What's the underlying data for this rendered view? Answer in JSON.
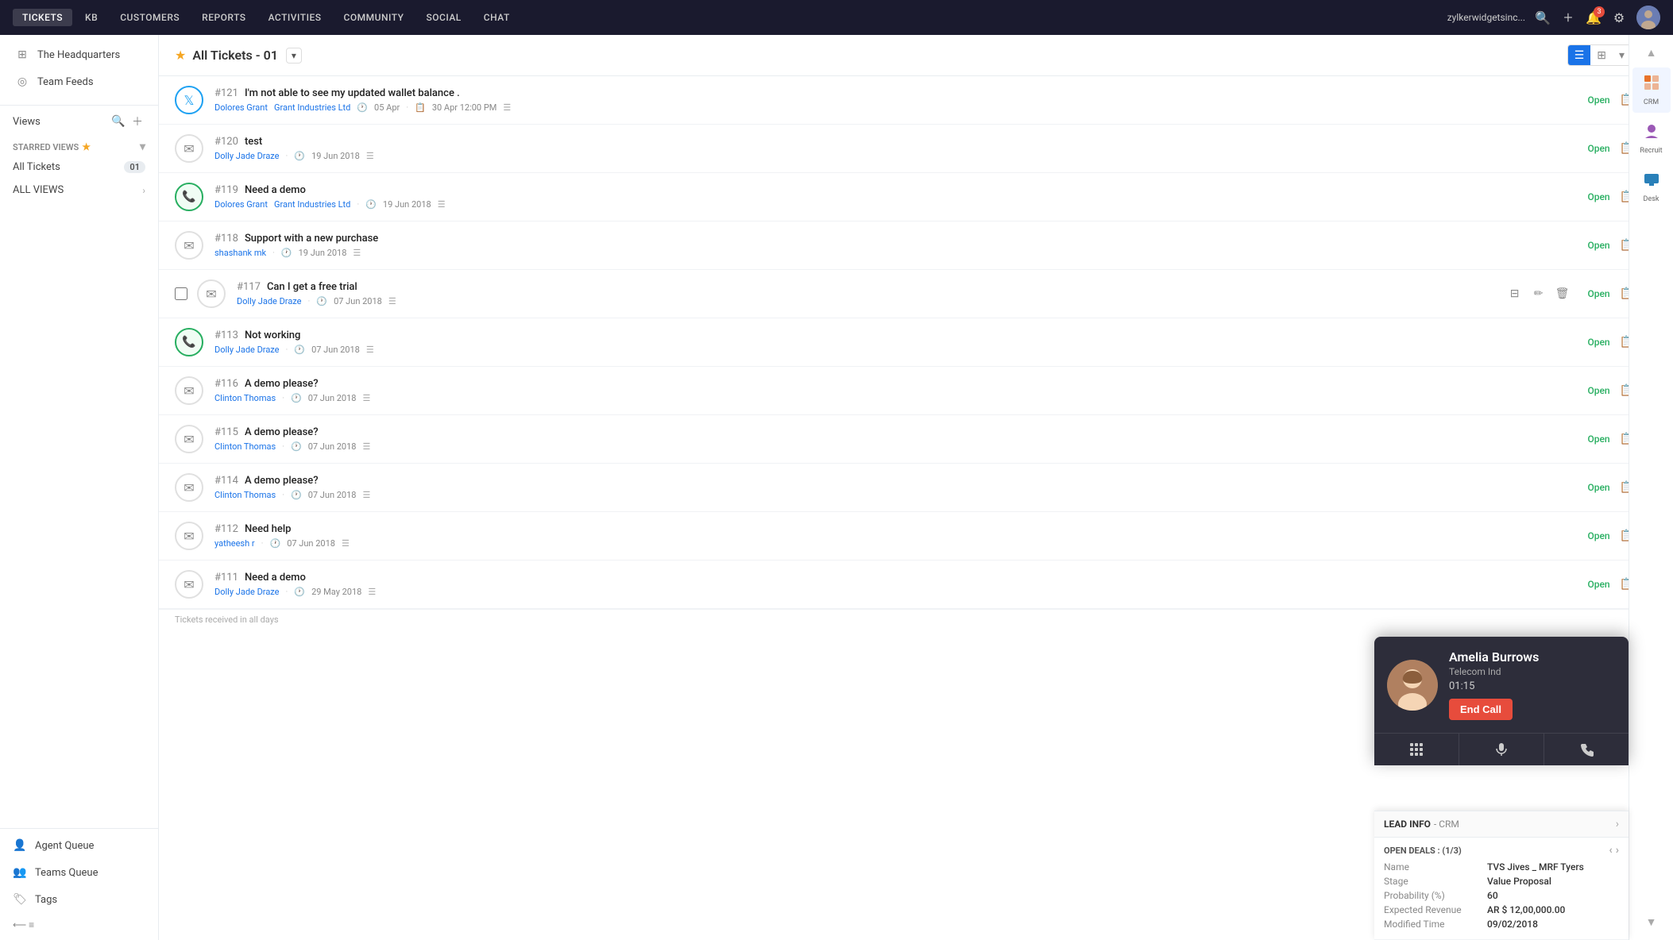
{
  "nav": {
    "items": [
      {
        "label": "TICKETS",
        "active": true
      },
      {
        "label": "KB",
        "active": false
      },
      {
        "label": "CUSTOMERS",
        "active": false
      },
      {
        "label": "REPORTS",
        "active": false
      },
      {
        "label": "ACTIVITIES",
        "active": false
      },
      {
        "label": "COMMUNITY",
        "active": false
      },
      {
        "label": "SOCIAL",
        "active": false
      },
      {
        "label": "CHAT",
        "active": false
      }
    ],
    "company": "zylkerwidgetsinc...",
    "add_label": "+",
    "notif_count": "3"
  },
  "sidebar": {
    "headquarters_label": "The Headquarters",
    "team_feeds_label": "Team Feeds",
    "views_label": "Views",
    "starred_views_label": "STARRED VIEWS",
    "all_tickets_label": "All Tickets",
    "all_tickets_count": "01",
    "all_views_label": "ALL VIEWS",
    "agent_queue_label": "Agent Queue",
    "teams_queue_label": "Teams Queue",
    "tags_label": "Tags"
  },
  "tickets_header": {
    "star": "★",
    "title": "All Tickets - 01",
    "footer_text": "Tickets received in all days"
  },
  "tickets": [
    {
      "id": "121",
      "subject": "I'm not able to see my updated wallet balance .",
      "contact": "Dolores Grant",
      "company": "Grant Industries Ltd",
      "date1": "05 Apr",
      "date2": "30 Apr 12:00 PM",
      "status": "Open",
      "source": "twitter",
      "has_avatar": true,
      "avatar_type": "female"
    },
    {
      "id": "120",
      "subject": "test",
      "contact": "Dolly Jade Draze",
      "date1": "19 Jun 2018",
      "status": "Open",
      "source": "email",
      "has_avatar": false,
      "avatar_type": "neutral"
    },
    {
      "id": "119",
      "subject": "Need a demo",
      "contact": "Dolores Grant",
      "company": "Grant Industries Ltd",
      "date1": "19 Jun 2018",
      "status": "Open",
      "source": "call-active",
      "has_avatar": true,
      "avatar_type": "female"
    },
    {
      "id": "118",
      "subject": "Support with a new purchase",
      "contact": "shashank mk",
      "date1": "19 Jun 2018",
      "status": "Open",
      "source": "email",
      "has_avatar": false,
      "avatar_type": "neutral"
    },
    {
      "id": "117",
      "subject": "Can I get a free trial",
      "contact": "Dolly Jade Draze",
      "date1": "07 Jun 2018",
      "status": "Open",
      "source": "email",
      "has_avatar": false,
      "avatar_type": "neutral",
      "show_inline_actions": true
    },
    {
      "id": "113",
      "subject": "Not working",
      "contact": "Dolly Jade Draze",
      "date1": "07 Jun 2018",
      "status": "Open",
      "source": "call-active",
      "has_avatar": true,
      "avatar_type": "female"
    },
    {
      "id": "116",
      "subject": "A demo please?",
      "contact": "Clinton Thomas",
      "date1": "07 Jun 2018",
      "status": "Open",
      "source": "email",
      "has_avatar": false,
      "avatar_type": "neutral"
    },
    {
      "id": "115",
      "subject": "A demo please?",
      "contact": "Clinton Thomas",
      "date1": "07 Jun 2018",
      "status": "Open",
      "source": "email",
      "has_avatar": false,
      "avatar_type": "neutral"
    },
    {
      "id": "114",
      "subject": "A demo please?",
      "contact": "Clinton Thomas",
      "date1": "07 Jun 2018",
      "status": "Open",
      "source": "email",
      "has_avatar": false,
      "avatar_type": "neutral"
    },
    {
      "id": "112",
      "subject": "Need help",
      "contact": "yatheesh r",
      "date1": "07 Jun 2018",
      "status": "Open",
      "source": "email",
      "has_avatar": false,
      "avatar_type": "neutral"
    },
    {
      "id": "111",
      "subject": "Need a demo",
      "contact": "Dolly Jade Draze",
      "date1": "29 May 2018",
      "status": "Open",
      "source": "email",
      "has_avatar": false,
      "avatar_type": "neutral"
    }
  ],
  "call_popup": {
    "name": "Amelia Burrows",
    "company": "Telecom Ind",
    "timer": "01:15",
    "end_call_label": "End Call"
  },
  "crm_panel": {
    "title": "LEAD INFO",
    "subtitle": "CRM",
    "open_deals_label": "OPEN DEALS : (1/3)",
    "fields": [
      {
        "label": "Name",
        "value": "TVS Jives _ MRF Tyers"
      },
      {
        "label": "Stage",
        "value": "Value Proposal"
      },
      {
        "label": "Probability (%)",
        "value": "60"
      },
      {
        "label": "Expected Revenue",
        "value": "AR $ 12,00,000.00"
      },
      {
        "label": "Modified Time",
        "value": "09/02/2018"
      }
    ]
  },
  "right_panel": {
    "items": [
      {
        "label": "CRM",
        "icon": "crm",
        "active": true
      },
      {
        "label": "Recruit",
        "icon": "recruit",
        "active": false
      },
      {
        "label": "Desk",
        "icon": "desk",
        "active": false
      }
    ]
  }
}
